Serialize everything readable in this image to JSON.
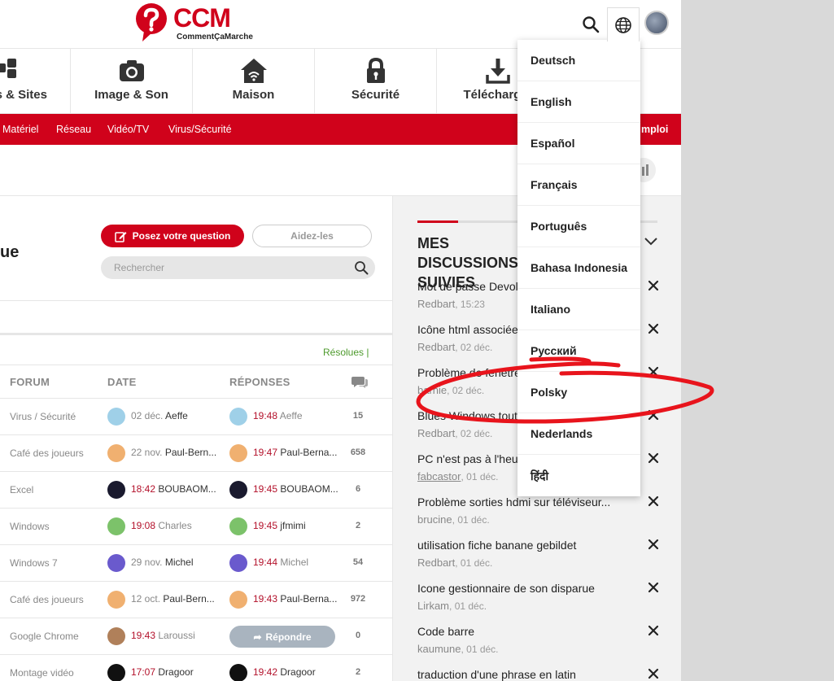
{
  "header": {
    "logo_text": "CCM",
    "logo_sub": "CommentÇaMarche"
  },
  "categories": [
    {
      "label": "s & Sites",
      "icon": "apps-icon"
    },
    {
      "label": "Image & Son",
      "icon": "camera-icon"
    },
    {
      "label": "Maison",
      "icon": "home-icon"
    },
    {
      "label": "Sécurité",
      "icon": "lock-icon"
    },
    {
      "label": "Télécharger",
      "icon": "download-icon"
    }
  ],
  "subnav": {
    "items": [
      "Matériel",
      "Réseau",
      "Vidéo/TV",
      "Virus/Sécurité"
    ],
    "right_partial": "mploi"
  },
  "main": {
    "title_partial": "ue",
    "ask_label": "Posez votre question",
    "help_label": "Aidez-les",
    "search_placeholder": "Rechercher",
    "filter_resolues": "Résolues |"
  },
  "table": {
    "headers": {
      "forum": "FORUM",
      "date": "DATE",
      "replies": "RÉPONSES"
    },
    "reply_label": "Répondre",
    "rows": [
      {
        "forum": "Virus / Sécurité",
        "date_time": "",
        "date_day": "02 déc.",
        "date_user": "Aeffe",
        "date_user_muted": false,
        "rep_time": "19:48",
        "rep_user": "Aeffe",
        "rep_user_muted": true,
        "count": "15"
      },
      {
        "forum": "Café des joueurs",
        "date_time": "",
        "date_day": "22 nov.",
        "date_user": "Paul-Bern...",
        "date_user_muted": false,
        "rep_time": "19:47",
        "rep_user": "Paul-Berna...",
        "rep_user_muted": false,
        "count": "658"
      },
      {
        "forum": "Excel",
        "date_time": "18:42",
        "date_day": "",
        "date_user": "BOUBAOM...",
        "date_user_muted": false,
        "rep_time": "19:45",
        "rep_user": "BOUBAOM...",
        "rep_user_muted": false,
        "count": "6"
      },
      {
        "forum": "Windows",
        "date_time": "19:08",
        "date_day": "",
        "date_user": "Charles",
        "date_user_muted": true,
        "rep_time": "19:45",
        "rep_user": "jfmimi",
        "rep_user_muted": false,
        "count": "2"
      },
      {
        "forum": "Windows 7",
        "date_time": "",
        "date_day": "29 nov.",
        "date_user": "Michel",
        "date_user_muted": false,
        "rep_time": "19:44",
        "rep_user": "Michel",
        "rep_user_muted": true,
        "count": "54"
      },
      {
        "forum": "Café des joueurs",
        "date_time": "",
        "date_day": "12 oct.",
        "date_user": "Paul-Bern...",
        "date_user_muted": false,
        "rep_time": "19:43",
        "rep_user": "Paul-Berna...",
        "rep_user_muted": false,
        "count": "972"
      },
      {
        "forum": "Google Chrome",
        "date_time": "19:43",
        "date_day": "",
        "date_user": "Laroussi",
        "date_user_muted": true,
        "rep_time": "",
        "rep_user": "",
        "rep_user_muted": false,
        "count": "0"
      },
      {
        "forum": "Montage vidéo",
        "date_time": "17:07",
        "date_day": "",
        "date_user": "Dragoor",
        "date_user_muted": false,
        "rep_time": "19:42",
        "rep_user": "Dragoor",
        "rep_user_muted": false,
        "count": "2"
      }
    ]
  },
  "sidebar": {
    "title": "MES DISCUSSIONS SUIVIES",
    "discussions": [
      {
        "title": "Mot de passe Devolo",
        "user": "Redbart",
        "when": "15:23",
        "user_link": false
      },
      {
        "title": "Icône html associée",
        "user": "Redbart",
        "when": "02 déc.",
        "user_link": false
      },
      {
        "title": "Problème de fenêtre",
        "user": "barnie",
        "when": "02 déc.",
        "user_link": false
      },
      {
        "title": "Blues Windows tout",
        "user": "Redbart",
        "when": "02 déc.",
        "user_link": false
      },
      {
        "title": "PC n'est pas à l'heure",
        "user": "fabcastor",
        "when": "01 déc.",
        "user_link": true
      },
      {
        "title": "Problème sorties hdmi sur téléviseur...",
        "user": "brucine",
        "when": "01 déc.",
        "user_link": false
      },
      {
        "title": "utilisation fiche banane gebildet",
        "user": "Redbart",
        "when": "01 déc.",
        "user_link": false
      },
      {
        "title": "Icone gestionnaire de son disparue",
        "user": "Lirkam",
        "when": "01 déc.",
        "user_link": false
      },
      {
        "title": "Code barre",
        "user": "kaumune",
        "when": "01 déc.",
        "user_link": false
      },
      {
        "title": "traduction d'une phrase en latin",
        "user": "",
        "when": "",
        "user_link": false
      }
    ]
  },
  "languages": [
    "Deutsch",
    "English",
    "Español",
    "Français",
    "Português",
    "Bahasa Indonesia",
    "Italiano",
    "Русский",
    "Polsky",
    "Nederlands",
    "हिंदी"
  ],
  "colors": {
    "brand": "#d0021b",
    "annotation": "#e8141c"
  }
}
